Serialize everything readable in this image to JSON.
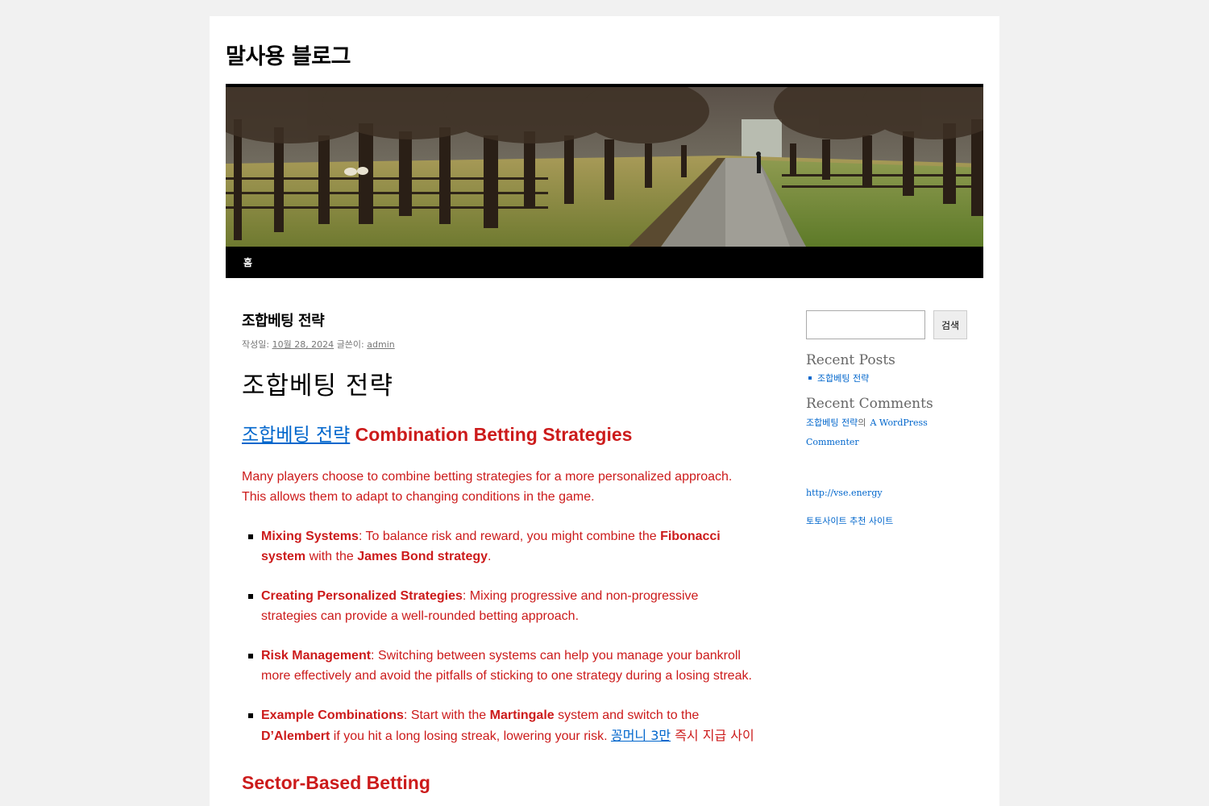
{
  "site": {
    "title": "말사용 블로그"
  },
  "nav": {
    "home": "홈"
  },
  "post": {
    "title": "조합베팅 전략",
    "meta_posted_label": "작성일:",
    "meta_date": "10월 28, 2024",
    "meta_author_label": "글쓴이:",
    "meta_author": "admin",
    "heading": "조합베팅 전략",
    "sub_link": "조합베팅 전략",
    "sub_rest": "Combination Betting Strategies",
    "intro": "Many players choose to combine betting strategies for a more personalized approach. This allows them to adapt to changing conditions in the game.",
    "items": [
      {
        "bold": "Mixing Systems",
        "t1": ": To balance risk and reward, you might combine the ",
        "b2": "Fibonacci system",
        "t2": " with the ",
        "b3": "James Bond  strategy",
        "t3": "."
      },
      {
        "bold": "Creating Personalized Strategies",
        "t1": ": Mixing progressive and non-progressive strategies can provide a well-rounded betting approach."
      },
      {
        "bold": "Risk Management",
        "t1": ": Switching between systems can help you manage your bankroll more effectively and avoid the pitfalls of sticking to one strategy during a losing streak."
      },
      {
        "bold": "Example Combinations",
        "t1": ": Start with the ",
        "b2": "Martingale",
        "t2": " system and switch to the ",
        "b3": "D’Alembert",
        "t3": " if you hit a long losing streak, lowering your risk. ",
        "link": "꽁머니 3만",
        "tail": " 즉시 지급 사이"
      }
    ],
    "section_title": "Sector-Based Betting"
  },
  "sidebar": {
    "search_button": "검색",
    "search_placeholder": "",
    "recent_posts_title": "Recent Posts",
    "recent_posts": [
      "조합베팅 전략"
    ],
    "recent_comments_title": "Recent Comments",
    "comment_post": "조합베팅 전략",
    "comment_joiner": "의",
    "comment_author": "A WordPress Commenter",
    "link1": "http://vse.energy",
    "link2": "토토사이트 추천 사이트"
  }
}
